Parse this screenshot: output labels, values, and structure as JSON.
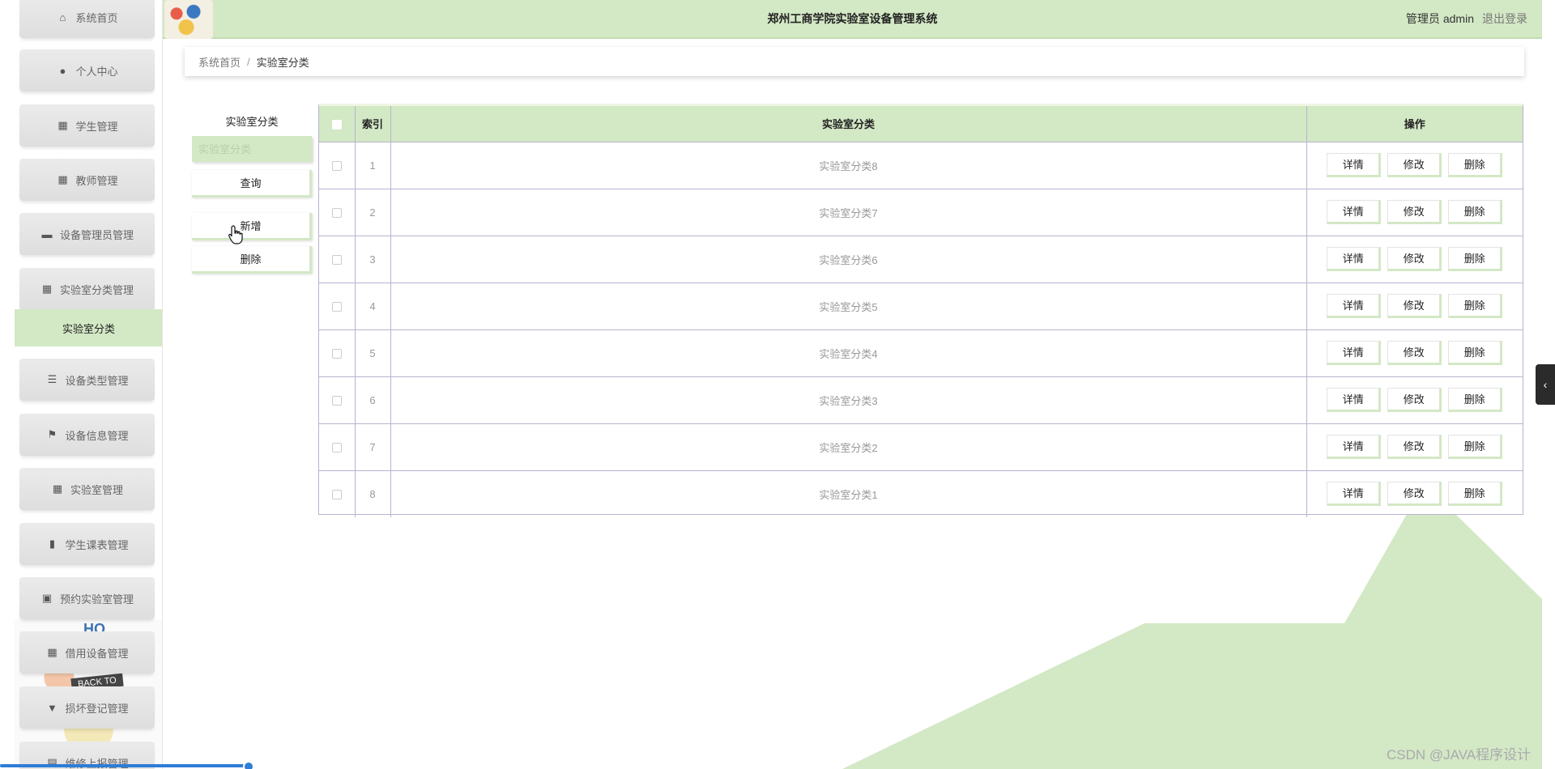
{
  "header": {
    "title": "郑州工商学院实验室设备管理系统",
    "user_role": "管理员",
    "user_name": "admin",
    "logout_label": "退出登录"
  },
  "sidebar": {
    "items": [
      {
        "label": "系统首页",
        "icon": "home-icon"
      },
      {
        "label": "个人中心",
        "icon": "user-icon"
      },
      {
        "label": "学生管理",
        "icon": "grid-icon"
      },
      {
        "label": "教师管理",
        "icon": "grid-icon"
      },
      {
        "label": "设备管理员管理",
        "icon": "chat-icon"
      },
      {
        "label": "实验室分类管理",
        "icon": "grid-icon"
      },
      {
        "label": "实验室分类",
        "icon": "",
        "active": true
      },
      {
        "label": "设备类型管理",
        "icon": "sliders-icon"
      },
      {
        "label": "设备信息管理",
        "icon": "flag-icon"
      },
      {
        "label": "实验室管理",
        "icon": "grid-icon"
      },
      {
        "label": "学生课表管理",
        "icon": "bar-chart-icon"
      },
      {
        "label": "预约实验室管理",
        "icon": "clipboard-icon"
      },
      {
        "label": "借用设备管理",
        "icon": "grid-icon"
      },
      {
        "label": "损坏登记管理",
        "icon": "hammer-icon"
      },
      {
        "label": "维修上报管理",
        "icon": "lock-icon"
      }
    ],
    "art_text": "HO",
    "art_banner": "BACK TO"
  },
  "breadcrumb": {
    "home": "系统首页",
    "separator": "/",
    "current": "实验室分类"
  },
  "search": {
    "label": "实验室分类",
    "placeholder": "实验室分类",
    "query_button": "查询",
    "add_button": "新增",
    "delete_button": "删除"
  },
  "table": {
    "columns": [
      "索引",
      "实验室分类",
      "操作"
    ],
    "actions": {
      "detail": "详情",
      "edit": "修改",
      "delete": "删除"
    },
    "rows": [
      {
        "index": "1",
        "name": "实验室分类8"
      },
      {
        "index": "2",
        "name": "实验室分类7"
      },
      {
        "index": "3",
        "name": "实验室分类6"
      },
      {
        "index": "4",
        "name": "实验室分类5"
      },
      {
        "index": "5",
        "name": "实验室分类4"
      },
      {
        "index": "6",
        "name": "实验室分类3"
      },
      {
        "index": "7",
        "name": "实验室分类2"
      },
      {
        "index": "8",
        "name": "实验室分类1"
      }
    ]
  },
  "colors": {
    "accent": "#d3e8c5",
    "table_border": "#b7b4cf"
  },
  "watermark": "CSDN @JAVA程序设计"
}
